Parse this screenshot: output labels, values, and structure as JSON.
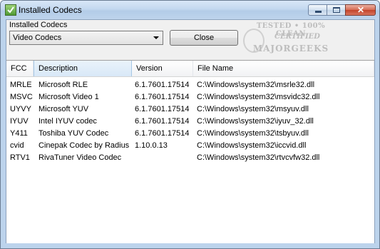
{
  "window": {
    "title": "Installed Codecs",
    "controls": {
      "minimize": "–",
      "maximize": "□",
      "close": "✕"
    }
  },
  "toolbar": {
    "group_label": "Installed Codecs",
    "codec_type_selected": "Video Codecs",
    "close_label": "Close"
  },
  "watermark": {
    "line1": "TESTED • 100% CLEAN",
    "line2": "CERTIFIED",
    "line3": "MAJORGEEKS"
  },
  "table": {
    "columns": [
      "FCC",
      "Description",
      "Version",
      "File Name"
    ],
    "rows": [
      [
        "MRLE",
        "Microsoft RLE",
        "6.1.7601.17514",
        "C:\\Windows\\system32\\msrle32.dll"
      ],
      [
        "MSVC",
        "Microsoft Video 1",
        "6.1.7601.17514",
        "C:\\Windows\\system32\\msvidc32.dll"
      ],
      [
        "UYVY",
        "Microsoft YUV",
        "6.1.7601.17514",
        "C:\\Windows\\system32\\msyuv.dll"
      ],
      [
        "IYUV",
        "Intel IYUV codec",
        "6.1.7601.17514",
        "C:\\Windows\\system32\\iyuv_32.dll"
      ],
      [
        "Y411",
        "Toshiba YUV Codec",
        "6.1.7601.17514",
        "C:\\Windows\\system32\\tsbyuv.dll"
      ],
      [
        "cvid",
        "Cinepak Codec by Radius",
        "1.10.0.13",
        "C:\\Windows\\system32\\iccvid.dll"
      ],
      [
        "RTV1",
        "RivaTuner Video Codec",
        "",
        "C:\\Windows\\system32\\rtvcvfw32.dll"
      ]
    ]
  }
}
